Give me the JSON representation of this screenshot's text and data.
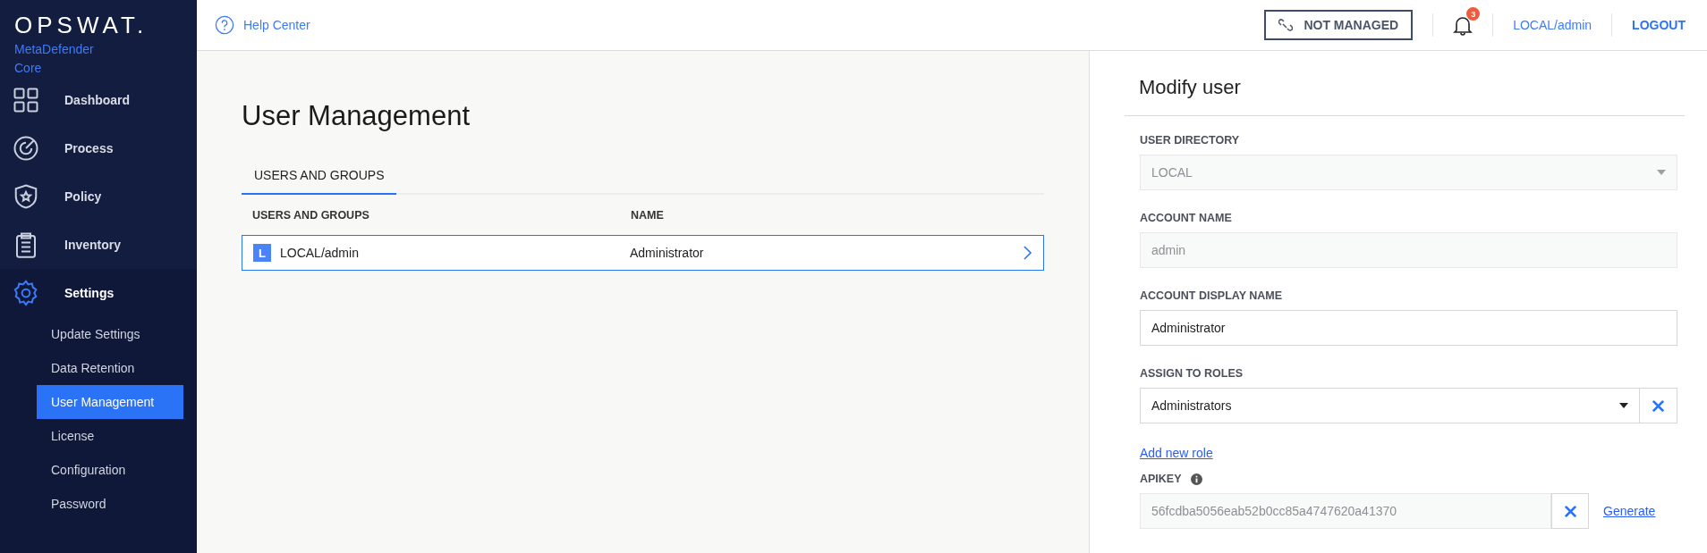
{
  "sidebar": {
    "logo": "OPSWAT.",
    "product": [
      "MetaDefender",
      "Core"
    ],
    "items": [
      {
        "label": "Dashboard",
        "selected": false
      },
      {
        "label": "Process",
        "selected": false
      },
      {
        "label": "Policy",
        "selected": false
      },
      {
        "label": "Inventory",
        "selected": false
      },
      {
        "label": "Settings",
        "selected": true,
        "children": [
          {
            "label": "Update Settings",
            "selected": false
          },
          {
            "label": "Data Retention",
            "selected": false
          },
          {
            "label": "User Management",
            "selected": true
          },
          {
            "label": "License",
            "selected": false
          },
          {
            "label": "Configuration",
            "selected": false
          },
          {
            "label": "Password",
            "selected": false
          }
        ]
      }
    ]
  },
  "header": {
    "help": "Help Center",
    "managed_button": "NOT MANAGED",
    "notification_count": "3",
    "user": "LOCAL/admin",
    "logout": "LOGOUT"
  },
  "main": {
    "title": "User Management",
    "tabs": [
      {
        "label": "USERS AND GROUPS",
        "selected": true
      }
    ],
    "table": {
      "columns": [
        "USERS AND GROUPS",
        "NAME"
      ],
      "rows": [
        {
          "badge": "L",
          "user": "LOCAL/admin",
          "name": "Administrator",
          "selected": true
        }
      ]
    }
  },
  "panel": {
    "title": "Modify user",
    "fields": [
      {
        "kind": "select",
        "label": "USER DIRECTORY",
        "value": "LOCAL",
        "disabled": true
      },
      {
        "kind": "input",
        "label": "ACCOUNT NAME",
        "value": "admin",
        "disabled": true
      },
      {
        "kind": "input",
        "label": "ACCOUNT DISPLAY NAME",
        "value": "Administrator",
        "disabled": false
      },
      {
        "kind": "role",
        "label": "ASSIGN TO ROLES",
        "value": "Administrators",
        "disabled": false
      }
    ],
    "add_role": "Add new role",
    "apikey": {
      "label": "APIKEY",
      "value": "56fcdba5056eab52b0cc85a4747620a41370",
      "generate": "Generate"
    }
  }
}
